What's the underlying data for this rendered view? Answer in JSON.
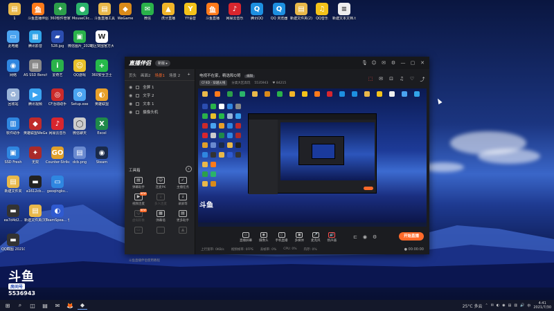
{
  "desktop": {
    "icons": [
      {
        "label": "1",
        "color": "#e8b84a",
        "glyph": "▤"
      },
      {
        "label": "斗鱼直播伴侣",
        "color": "#ff7a1a",
        "glyph": "鱼"
      },
      {
        "label": "360软件管家",
        "color": "#2c9f4a",
        "glyph": "✦"
      },
      {
        "label": "MouseClic...",
        "color": "#2bb36a",
        "glyph": "●"
      },
      {
        "label": "斗鱼直播工具",
        "color": "#e8b84a",
        "glyph": "▤"
      },
      {
        "label": "WeGame",
        "color": "#d98a1a",
        "glyph": "◆"
      },
      {
        "label": "微信",
        "color": "#2ab24a",
        "glyph": "✉"
      },
      {
        "label": "虎牙直播",
        "color": "#f0b429",
        "glyph": "▲"
      },
      {
        "label": "YY语音",
        "color": "#f3c21a",
        "glyph": "Y"
      },
      {
        "label": "斗鱼直播",
        "color": "#ff7a1a",
        "glyph": "鱼"
      },
      {
        "label": "网易云音乐",
        "color": "#d8262e",
        "glyph": "♪"
      },
      {
        "label": "腾讯QQ",
        "color": "#1d8fe0",
        "glyph": "Q"
      },
      {
        "label": "QQ 浏览器",
        "color": "#1d8fe0",
        "glyph": "Q"
      },
      {
        "label": "新建文件夹(2)",
        "color": "#e8b84a",
        "glyph": "▤"
      },
      {
        "label": "QQ音乐",
        "color": "#f3c21a",
        "glyph": "♫"
      },
      {
        "label": "新建文本文档.txt",
        "color": "#eeeeee",
        "glyph": "≡"
      },
      {
        "label": "此电脑",
        "color": "#4aa3f0",
        "glyph": "▭"
      },
      {
        "label": "腾讯影音",
        "color": "#31a4e8",
        "glyph": "▦"
      },
      {
        "label": "528.jpg",
        "color": "#2b4db0",
        "glyph": "▰"
      },
      {
        "label": "微信图片_202105...",
        "color": "#2ab24a",
        "glyph": "▣"
      },
      {
        "label": "暗区突围官方大服务器",
        "color": "#ffffff",
        "glyph": "W"
      },
      {
        "label": "网络",
        "color": "#2f86e0",
        "glyph": "◉"
      },
      {
        "label": "AS SSD Benchmar...",
        "color": "#888888",
        "glyph": "▤"
      },
      {
        "label": "爱奇艺",
        "color": "#2ab24a",
        "glyph": "i"
      },
      {
        "label": "QQ游戏",
        "color": "#e8c02a",
        "glyph": "☺"
      },
      {
        "label": "360安全卫士",
        "color": "#26b94a",
        "glyph": "+"
      },
      {
        "label": "回收站",
        "color": "#9ab4d8",
        "glyph": "♻"
      },
      {
        "label": "腾讯视频",
        "color": "#3aa3f0",
        "glyph": "▶"
      },
      {
        "label": "CF活动助手",
        "color": "#cc2a2a",
        "glyph": "◎"
      },
      {
        "label": "Setup.exe",
        "color": "#4aa3f0",
        "glyph": "⚙"
      },
      {
        "label": "英雄联盟",
        "color": "#e8a02a",
        "glyph": "◐"
      },
      {
        "label": "软件助手",
        "color": "#2f86e0",
        "glyph": "▥"
      },
      {
        "label": "英雄联盟WeGame版",
        "color": "#c02a2a",
        "glyph": "◆"
      },
      {
        "label": "网易云音乐",
        "color": "#d8262e",
        "glyph": "♪"
      },
      {
        "label": "微信聊天",
        "color": "#cccccc",
        "glyph": "◯"
      },
      {
        "label": "Excel",
        "color": "#1f8a4a",
        "glyph": "X"
      },
      {
        "label": "SSD Fresh",
        "color": "#2f86e0",
        "glyph": "▣"
      },
      {
        "label": "无双",
        "color": "#aa2a2a",
        "glyph": "✦"
      },
      {
        "label": "Counter-Strike",
        "color": "#e0a02a",
        "glyph": "GO"
      },
      {
        "label": "dcb.png",
        "color": "#6a8ad0",
        "glyph": "▤"
      },
      {
        "label": "Steam",
        "color": "#1a2a4a",
        "glyph": "◉"
      },
      {
        "label": "新建文件夹",
        "color": "#e8b84a",
        "glyph": "▤"
      },
      {
        "label": "a1612cb...",
        "color": "#222222",
        "glyph": "▬"
      },
      {
        "label": "geoqingkv...",
        "color": "#2f86e0",
        "glyph": "▭"
      },
      {
        "label": "ea7d4d2...",
        "color": "#333333",
        "glyph": "▬"
      },
      {
        "label": "新建文件夹(3)",
        "color": "#e8b84a",
        "glyph": "▤"
      },
      {
        "label": "TeamSpea... 快捷方式",
        "color": "#2f5ad0",
        "glyph": "◐"
      },
      {
        "label": "QQ截图 20210725...",
        "color": "#333333",
        "glyph": "▬"
      }
    ],
    "douyu_logo": "斗鱼",
    "douyu_sub": "房间号",
    "room_number": "5536943"
  },
  "app": {
    "name": "直播伴侣",
    "version_badge": "新版 ▸",
    "title_tools": [
      "🎙",
      "☺",
      "✉",
      "⚙",
      "—",
      "▢",
      "✕"
    ],
    "scene_tabs": [
      {
        "label": "页头",
        "active": false
      },
      {
        "label": "画面2",
        "active": false
      },
      {
        "label": "场景1",
        "active": true
      },
      {
        "label": "场景 2",
        "active": false
      }
    ],
    "add_scene": "+",
    "sources": [
      "全屏 1",
      "文字 2",
      "文本 1",
      "摄像头机"
    ],
    "toolbox_label": "工具箱",
    "toolbox_more": "›",
    "tools": [
      {
        "label": "弹幕助手",
        "glyph": "▤",
        "new": "",
        "dim": false
      },
      {
        "label": "连麦PK",
        "glyph": "☺",
        "new": "",
        "dim": false
      },
      {
        "label": "主播任务",
        "glyph": "✓",
        "new": "",
        "dim": false
      },
      {
        "label": "视频连麦",
        "glyph": "▶",
        "new": "NEW",
        "dim": false
      },
      {
        "label": "多人连麦",
        "glyph": "⇣",
        "new": "",
        "dim": true
      },
      {
        "label": "录屏等",
        "glyph": "⇣",
        "new": "",
        "dim": false
      },
      {
        "label": "虚拟形象",
        "glyph": "☺",
        "new": "NEW",
        "dim": true
      },
      {
        "label": "弹幕墙",
        "glyph": "▦",
        "new": "",
        "dim": false
      },
      {
        "label": "更多助手",
        "glyph": "▤",
        "new": "",
        "dim": false
      },
      {
        "label": "",
        "glyph": "▭",
        "new": "",
        "dim": true
      },
      {
        "label": "",
        "glyph": "",
        "new": "",
        "dim": true
      },
      {
        "label": "",
        "glyph": "▲",
        "new": "",
        "dim": true
      }
    ],
    "notice": "斗鱼直播伴侣使用教程",
    "stream_title": "电视不在家，精选和Q哥",
    "edit_tag": "编辑",
    "game_tag": "CF4D · 穿越火线",
    "category": "分类大区高玩",
    "room_id": "5535943",
    "followers": "♥ 84215",
    "main_tools": [
      "⬚",
      "✉",
      "⊡",
      "♫",
      "♡",
      "⤴"
    ],
    "controls": [
      {
        "label": "直播屏幕",
        "glyph": "▭",
        "red": false
      },
      {
        "label": "摄像头",
        "glyph": "◉",
        "red": false
      },
      {
        "label": "手机直播",
        "glyph": "▯",
        "red": false
      },
      {
        "label": "多媒体",
        "glyph": "▣",
        "red": false
      },
      {
        "label": "麦克风",
        "glyph": "🎤",
        "red": false
      },
      {
        "label": "扬声器",
        "glyph": "🔊",
        "red": true
      }
    ],
    "side_controls": [
      "⊏",
      "◉",
      "⚙"
    ],
    "live_button": "开始直播",
    "status": [
      "上行宽带: 0KB/s",
      "视频帧率: 0FPS",
      "丢帧率: 0%",
      "CPU: 0%",
      "内存: 0%"
    ],
    "timer": "● 00:00:00",
    "preview_watermark": "斗鱼"
  },
  "taskbar": {
    "start": "⊞",
    "apps": [
      "⌕",
      "◫",
      "▤",
      "✉",
      "🦊",
      "◆"
    ],
    "weather": "25°C 多云",
    "tray_icons": [
      "⌃",
      "✉",
      "◐",
      "◉",
      "▤",
      "▥",
      "🔊",
      "中"
    ],
    "time": "4:41",
    "date": "2021/7/30"
  }
}
